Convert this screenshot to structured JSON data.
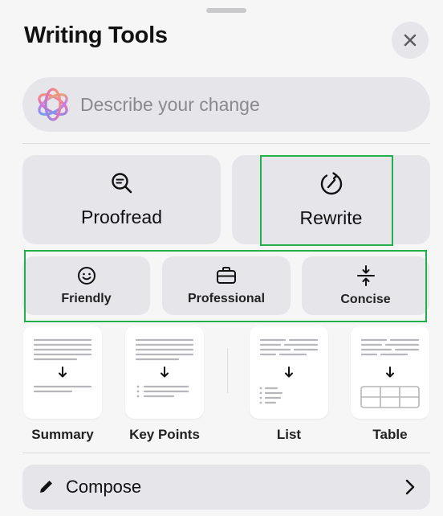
{
  "header": {
    "title": "Writing Tools",
    "close_icon": "close-icon"
  },
  "search": {
    "placeholder": "Describe your change",
    "icon": "apple-intelligence-icon"
  },
  "primary_actions": [
    {
      "label": "Proofread",
      "icon": "magnifier-icon"
    },
    {
      "label": "Rewrite",
      "icon": "rewrite-icon"
    }
  ],
  "tones": [
    {
      "label": "Friendly",
      "icon": "smiley-icon"
    },
    {
      "label": "Professional",
      "icon": "briefcase-icon"
    },
    {
      "label": "Concise",
      "icon": "compress-icon"
    }
  ],
  "formats": [
    {
      "label": "Summary"
    },
    {
      "label": "Key Points"
    },
    {
      "label": "List"
    },
    {
      "label": "Table"
    }
  ],
  "compose": {
    "label": "Compose",
    "icon": "pencil-icon",
    "chevron": "chevron-right-icon"
  },
  "colors": {
    "highlight": "#22b04b",
    "button_bg": "#e6e6ea",
    "sheet_bg": "#f6f6f7"
  }
}
